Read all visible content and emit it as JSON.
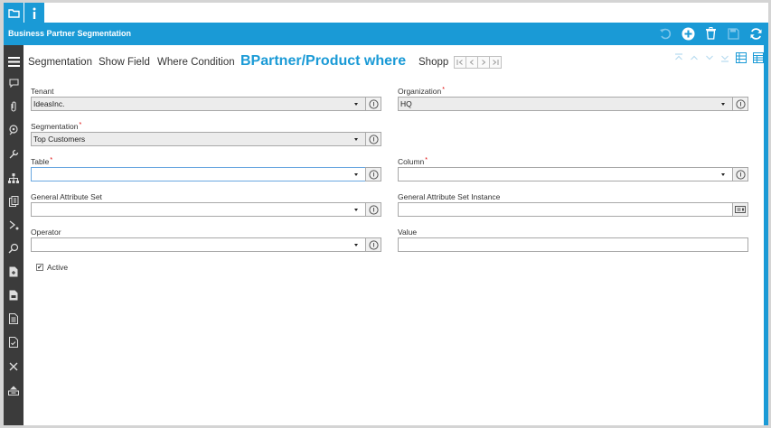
{
  "window": {
    "title": "Business Partner Segmentation"
  },
  "tabs": [
    {
      "label": "Segmentation"
    },
    {
      "label": "Show Field"
    },
    {
      "label": "Where Condition"
    },
    {
      "label": "BPartner/Product where"
    },
    {
      "label": "Shopping"
    }
  ],
  "form": {
    "tenant": {
      "label": "Tenant",
      "value": "IdeasInc."
    },
    "organization": {
      "label": "Organization",
      "value": "HQ"
    },
    "segmentation": {
      "label": "Segmentation",
      "value": "Top Customers"
    },
    "table": {
      "label": "Table",
      "value": ""
    },
    "column": {
      "label": "Column",
      "value": ""
    },
    "general_attribute_set": {
      "label": "General Attribute Set",
      "value": ""
    },
    "general_attribute_set_instance": {
      "label": "General Attribute Set Instance",
      "value": ""
    },
    "operator": {
      "label": "Operator",
      "value": ""
    },
    "value": {
      "label": "Value",
      "value": ""
    },
    "active": {
      "label": "Active",
      "checked": true
    }
  },
  "required_mark": "*",
  "colors": {
    "accent": "#1a9ad6",
    "sidebar": "#3b3b3b"
  },
  "icons": {
    "top_tab_1": "folder-icon",
    "top_tab_2": "info-icon",
    "toolbar": [
      "undo-icon",
      "new-record-icon",
      "delete-icon",
      "save-icon",
      "refresh-icon"
    ],
    "sidebar": [
      "menu-icon",
      "chat-icon",
      "attachment-icon",
      "lookup-icon",
      "tools-icon",
      "hierarchy-icon",
      "report-icon",
      "workflow-icon",
      "zoom-icon",
      "document-add-icon",
      "document-icon",
      "document-list-icon",
      "document-check-icon",
      "close-icon",
      "archive-icon"
    ]
  }
}
